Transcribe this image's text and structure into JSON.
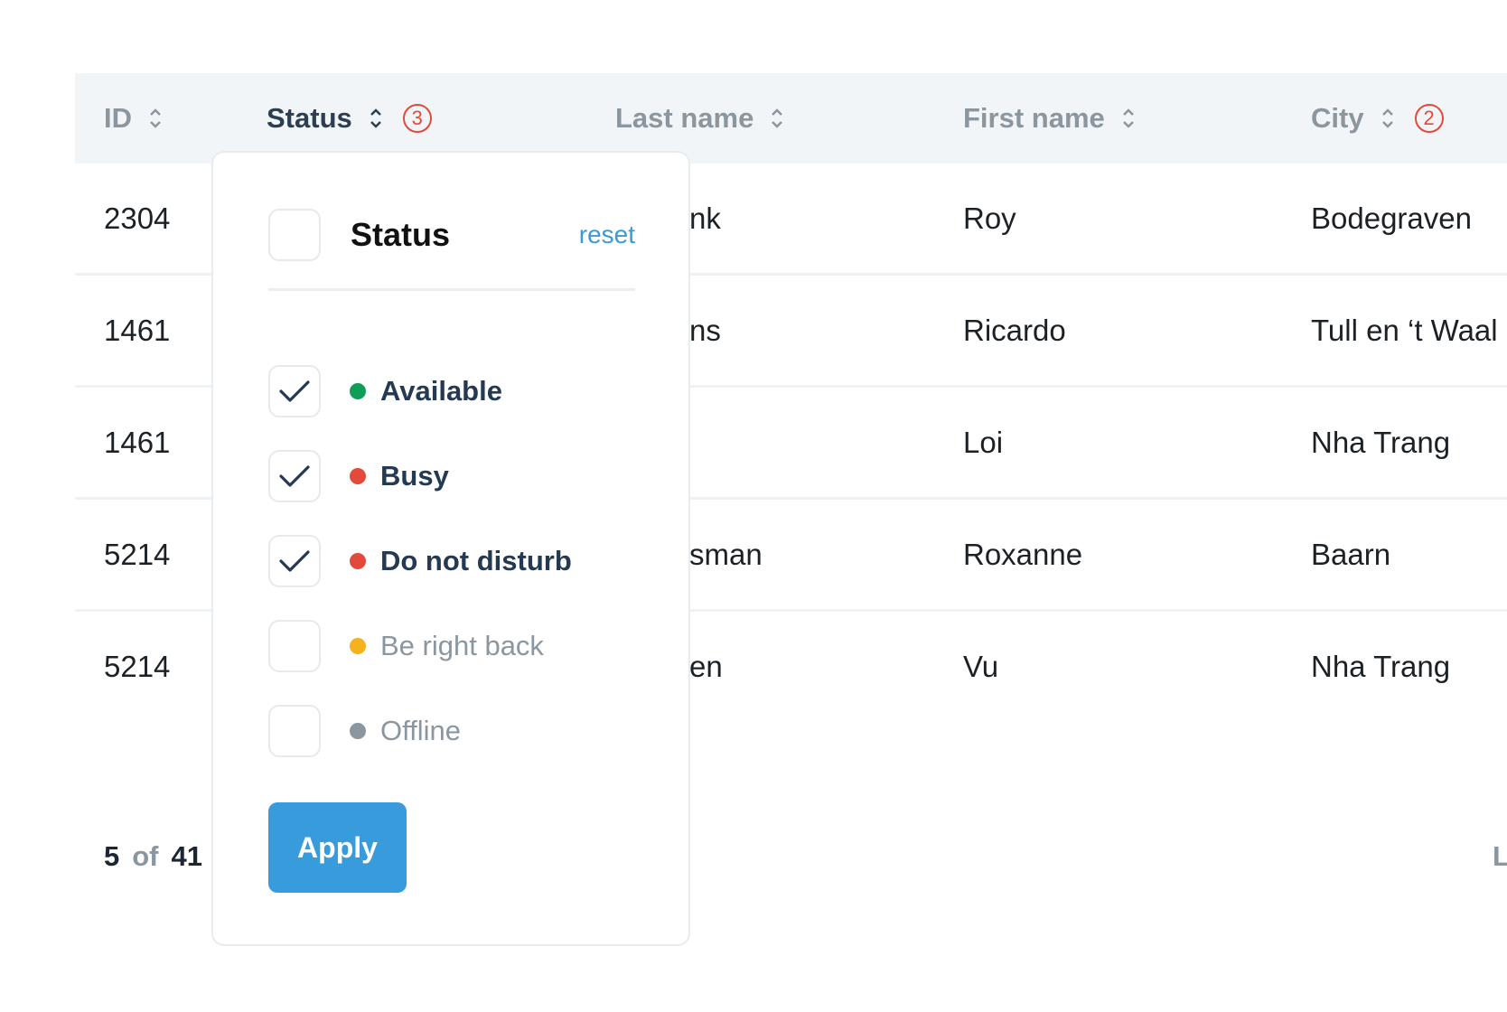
{
  "columns": {
    "id": "ID",
    "status": "Status",
    "status_filter_count": "3",
    "last_name": "Last name",
    "first_name": "First name",
    "city": "City",
    "city_filter_count": "2"
  },
  "rows": [
    {
      "id": "2304",
      "last_name": "nk",
      "first_name": "Roy",
      "city": "Bodegraven"
    },
    {
      "id": "1461",
      "last_name": "ns",
      "first_name": "Ricardo",
      "city": "Tull en ‘t Waal"
    },
    {
      "id": "1461",
      "last_name": "",
      "first_name": "Loi",
      "city": "Nha Trang"
    },
    {
      "id": "5214",
      "last_name": "sman",
      "first_name": "Roxanne",
      "city": "Baarn"
    },
    {
      "id": "5214",
      "last_name": "en",
      "first_name": "Vu",
      "city": "Nha Trang"
    }
  ],
  "footer": {
    "shown": "5",
    "of": "of",
    "total": "41",
    "right_text": "L"
  },
  "status_filter": {
    "title": "Status",
    "reset_label": "reset",
    "options": [
      {
        "label": "Available",
        "checked": true,
        "color": "#0f9d58"
      },
      {
        "label": "Busy",
        "checked": true,
        "color": "#e24a3b"
      },
      {
        "label": "Do not disturb",
        "checked": true,
        "color": "#e24a3b"
      },
      {
        "label": "Be right back",
        "checked": false,
        "color": "#f5b21b"
      },
      {
        "label": "Offline",
        "checked": false,
        "color": "#8b969f"
      }
    ],
    "apply_label": "Apply"
  },
  "icons": {
    "sort": "sort-updown-icon",
    "check": "check-icon"
  }
}
